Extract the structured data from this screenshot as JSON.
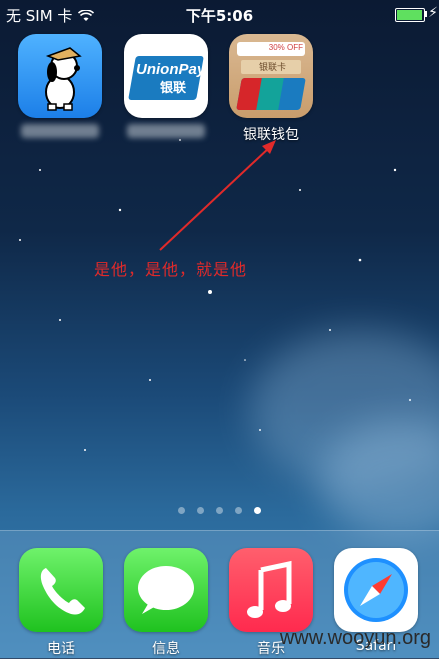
{
  "status_bar": {
    "carrier": "无 SIM 卡",
    "time": "下午5:06",
    "battery_level": 0.9
  },
  "apps": {
    "app1": {
      "label": ""
    },
    "app2": {
      "label": ""
    },
    "app3": {
      "label": "银联钱包",
      "badge": "30% OFF",
      "card_text": "银联卡"
    }
  },
  "annotation": {
    "text": "是他，是他，就是他"
  },
  "page_dots": {
    "count": 5,
    "active": 5
  },
  "dock": {
    "phone": "电话",
    "messages": "信息",
    "music": "音乐",
    "safari": "Safari"
  },
  "watermark": "www.wooyun.org",
  "colors": {
    "annotation": "#e02a2a",
    "phone": "#3ed33e",
    "music": "#ff3a5a"
  }
}
